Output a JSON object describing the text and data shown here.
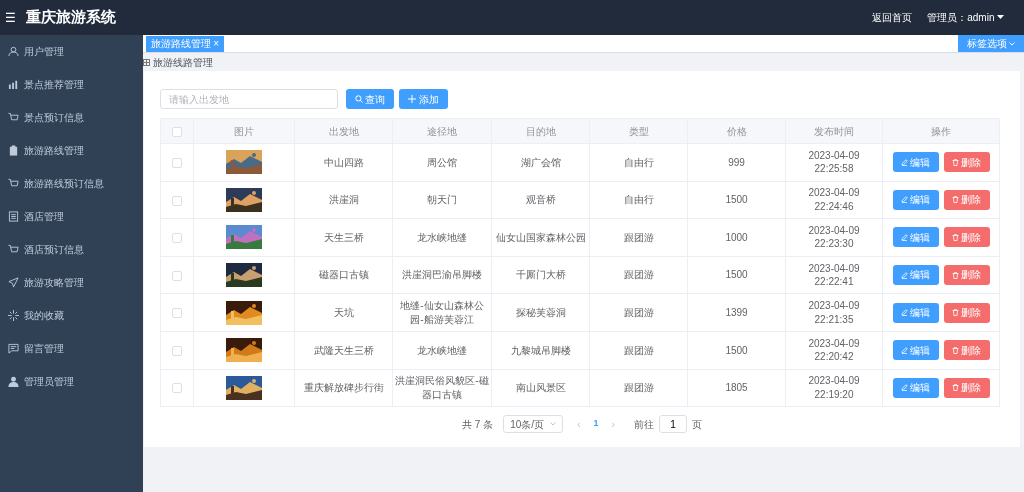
{
  "header": {
    "menu_icon": "☰",
    "title": "重庆旅游系统",
    "home_link": "返回首页",
    "user": "管理员：admin"
  },
  "sidebar": {
    "items": [
      {
        "label": "用户管理",
        "selected": false
      },
      {
        "label": "景点推荐管理",
        "selected": false
      },
      {
        "label": "景点预订信息",
        "selected": false
      },
      {
        "label": "旅游路线管理",
        "selected": false
      },
      {
        "label": "旅游路线预订信息",
        "selected": false
      },
      {
        "label": "酒店管理",
        "selected": false
      },
      {
        "label": "酒店预订信息",
        "selected": false
      },
      {
        "label": "旅游攻略管理",
        "selected": false
      },
      {
        "label": "我的收藏",
        "selected": false
      },
      {
        "label": "留言管理",
        "selected": false
      },
      {
        "label": "管理员管理",
        "selected": false
      }
    ]
  },
  "tabs": [
    {
      "label": "旅游路线管理",
      "close": "×",
      "selected": true
    }
  ],
  "tab_options": "标签选项",
  "breadcrumb": "旅游线路管理",
  "search": {
    "placeholder": "请输入出发地",
    "search_button": "查询",
    "add_button": "添加"
  },
  "table": {
    "select_all": {
      "checked": false
    },
    "columns": [
      "图片",
      "出发地",
      "途径地",
      "目的地",
      "类型",
      "价格",
      "发布时间",
      "操作"
    ],
    "rows": [
      {
        "checked": false,
        "from": "中山四路",
        "via": "周公馆",
        "to": "湖广会馆",
        "type": "自由行",
        "price": "999",
        "time": "2023-04-09 22:25:58",
        "edit": "编辑",
        "delete": "删除"
      },
      {
        "checked": false,
        "from": "洪崖洞",
        "via": "朝天门",
        "to": "观音桥",
        "type": "自由行",
        "price": "1500",
        "time": "2023-04-09 22:24:46",
        "edit": "编辑",
        "delete": "删除"
      },
      {
        "checked": false,
        "from": "天生三桥",
        "via": "龙水峡地缝",
        "to": "仙女山国家森林公园",
        "type": "跟团游",
        "price": "1000",
        "time": "2023-04-09 22:23:30",
        "edit": "编辑",
        "delete": "删除"
      },
      {
        "checked": false,
        "from": "磁器口古镇",
        "via": "洪崖洞巴渝吊脚楼",
        "to": "千厮门大桥",
        "type": "跟团游",
        "price": "1500",
        "time": "2023-04-09 22:22:41",
        "edit": "编辑",
        "delete": "删除"
      },
      {
        "checked": false,
        "from": "天坑",
        "via": "地缝-仙女山森林公园-船游芙蓉江",
        "to": "探秘芙蓉洞",
        "type": "跟团游",
        "price": "1399",
        "time": "2023-04-09 22:21:35",
        "edit": "编辑",
        "delete": "删除"
      },
      {
        "checked": false,
        "from": "武隆天生三桥",
        "via": "龙水峡地缝",
        "to": "九黎城吊脚楼",
        "type": "跟团游",
        "price": "1500",
        "time": "2023-04-09 22:20:42",
        "edit": "编辑",
        "delete": "删除"
      },
      {
        "checked": false,
        "from": "重庆解放碑步行街",
        "via": "洪崖洞民俗风貌区-磁器口古镇",
        "to": "南山风景区",
        "type": "跟团游",
        "price": "1805",
        "time": "2023-04-09 22:19:20",
        "edit": "编辑",
        "delete": "删除"
      }
    ]
  },
  "pagination": {
    "total": "共 7 条",
    "page_size": "10条/页",
    "prev": "‹",
    "pages": [
      {
        "label": "1",
        "selected": true
      }
    ],
    "next": "›",
    "goto_label": "前往",
    "goto_value": "1",
    "goto_suffix": "页"
  }
}
